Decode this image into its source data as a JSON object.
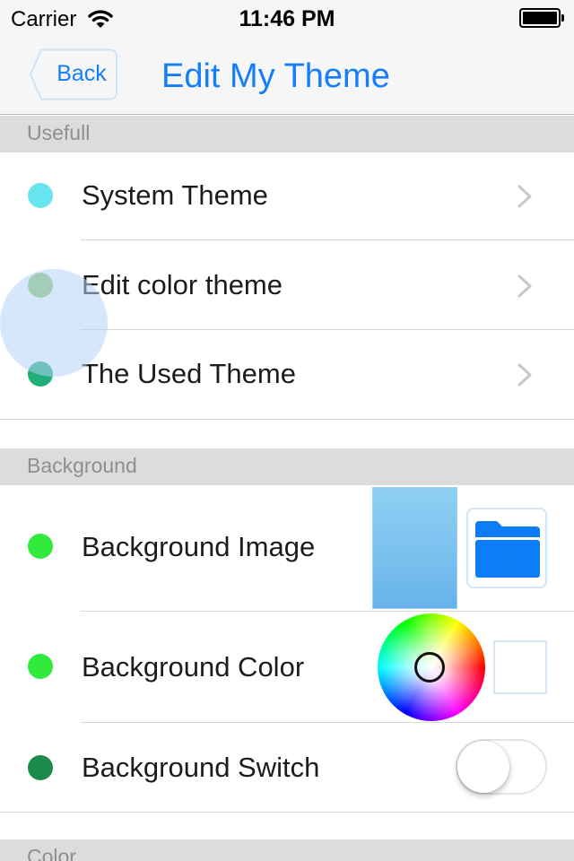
{
  "status_bar": {
    "carrier": "Carrier",
    "time": "11:46 PM",
    "icons": [
      "wifi-icon",
      "battery-icon"
    ]
  },
  "nav": {
    "back_label": "Back",
    "title": "Edit My Theme"
  },
  "sections": {
    "usefull": {
      "header": "Usefull",
      "rows": [
        {
          "label": "System Theme",
          "dot_color": "#66e5ef"
        },
        {
          "label": "Edit color theme",
          "dot_color": "#8cc86a"
        },
        {
          "label": "The Used Theme",
          "dot_color": "#1fae78"
        }
      ]
    },
    "background": {
      "header": "Background",
      "rows": [
        {
          "label": "Background Image",
          "dot_color": "#31ea3c"
        },
        {
          "label": "Background Color",
          "dot_color": "#31ea3c"
        },
        {
          "label": "Background Switch",
          "dot_color": "#1c8a4a"
        }
      ],
      "switch_on": false
    },
    "color": {
      "header": "Color"
    }
  },
  "colors": {
    "accent": "#157efb",
    "section_header_bg": "#dcdcdc",
    "folder_icon": "#0d7df7"
  }
}
